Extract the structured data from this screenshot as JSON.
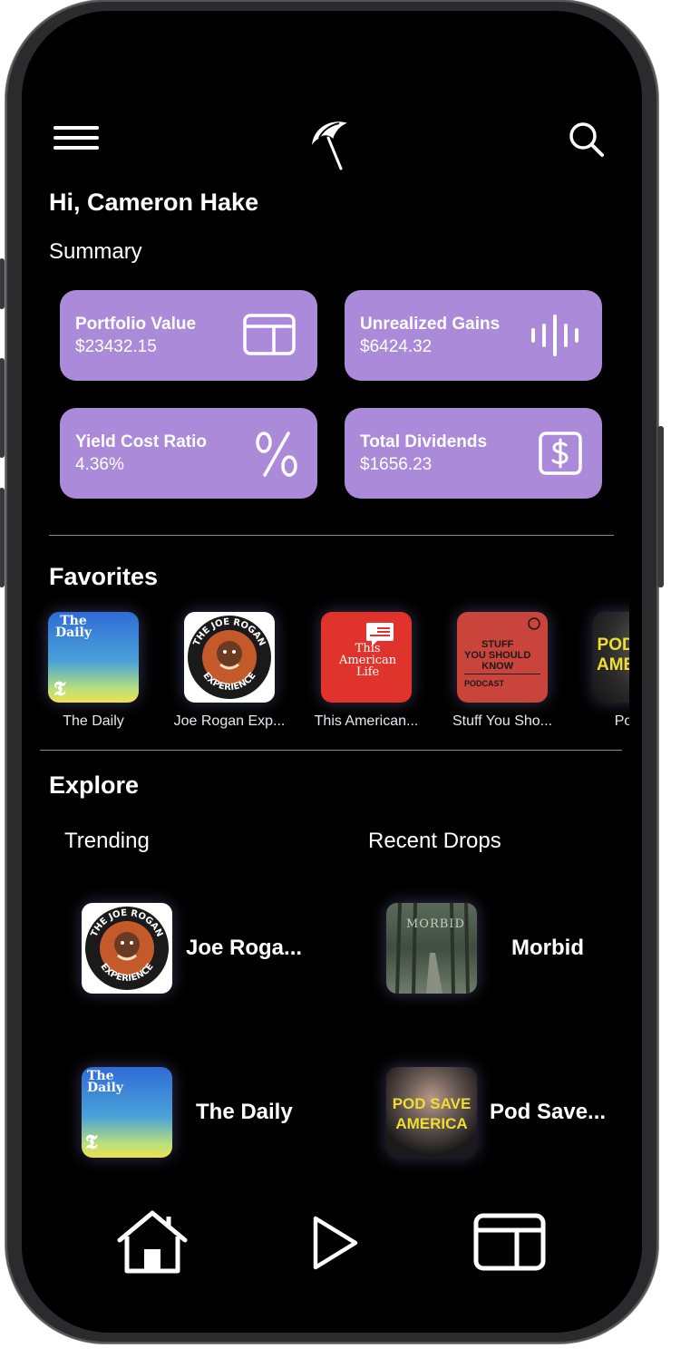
{
  "greeting": "Hi, Cameron Hake",
  "summary_label": "Summary",
  "cards": [
    {
      "title": "Portfolio Value",
      "value": "$23432.15",
      "icon": "portfolio-icon"
    },
    {
      "title": "Unrealized Gains",
      "value": "$6424.32",
      "icon": "waveform-icon"
    },
    {
      "title": "Yield Cost Ratio",
      "value": "4.36%",
      "icon": "percent-icon"
    },
    {
      "title": "Total Dividends",
      "value": "$1656.23",
      "icon": "dollar-icon"
    }
  ],
  "favorites": {
    "title": "Favorites",
    "items": [
      {
        "label": "The Daily",
        "art": "the-daily-art",
        "art_text": [
          "The",
          "Daily"
        ]
      },
      {
        "label": "Joe Rogan Exp...",
        "art": "joe-rogan-art",
        "art_text": [
          "THE JOE ROGAN",
          "EXPERIENCE"
        ]
      },
      {
        "label": "This American...",
        "art": "this-american-life-art",
        "art_text": [
          "This",
          "American",
          "Life"
        ]
      },
      {
        "label": "Stuff You Sho...",
        "art": "stuff-you-should-know-art",
        "art_text": [
          "STUFF",
          "YOU SHOULD",
          "KNOW",
          "PODCAST"
        ]
      },
      {
        "label": "Pod Sa",
        "art": "pod-save-america-art",
        "art_text": [
          "POD",
          "AME"
        ]
      }
    ]
  },
  "explore": {
    "title": "Explore",
    "trending_label": "Trending",
    "recent_label": "Recent Drops",
    "trending": [
      {
        "name": "Joe Roga...",
        "art": "joe-rogan-art"
      },
      {
        "name": "The Daily",
        "art": "the-daily-art",
        "art_text": [
          "The",
          "Daily"
        ]
      }
    ],
    "recent": [
      {
        "name": "Morbid",
        "art": "morbid-art",
        "art_text": "MORBID"
      },
      {
        "name": "Pod Save...",
        "art": "pod-save-america-art",
        "art_text": [
          "POD SAVE",
          "AMERICA"
        ]
      }
    ]
  },
  "nav": [
    "home-icon",
    "play-icon",
    "portfolio-icon"
  ],
  "colors": {
    "card": "#ab8ad9",
    "background": "#000000"
  }
}
